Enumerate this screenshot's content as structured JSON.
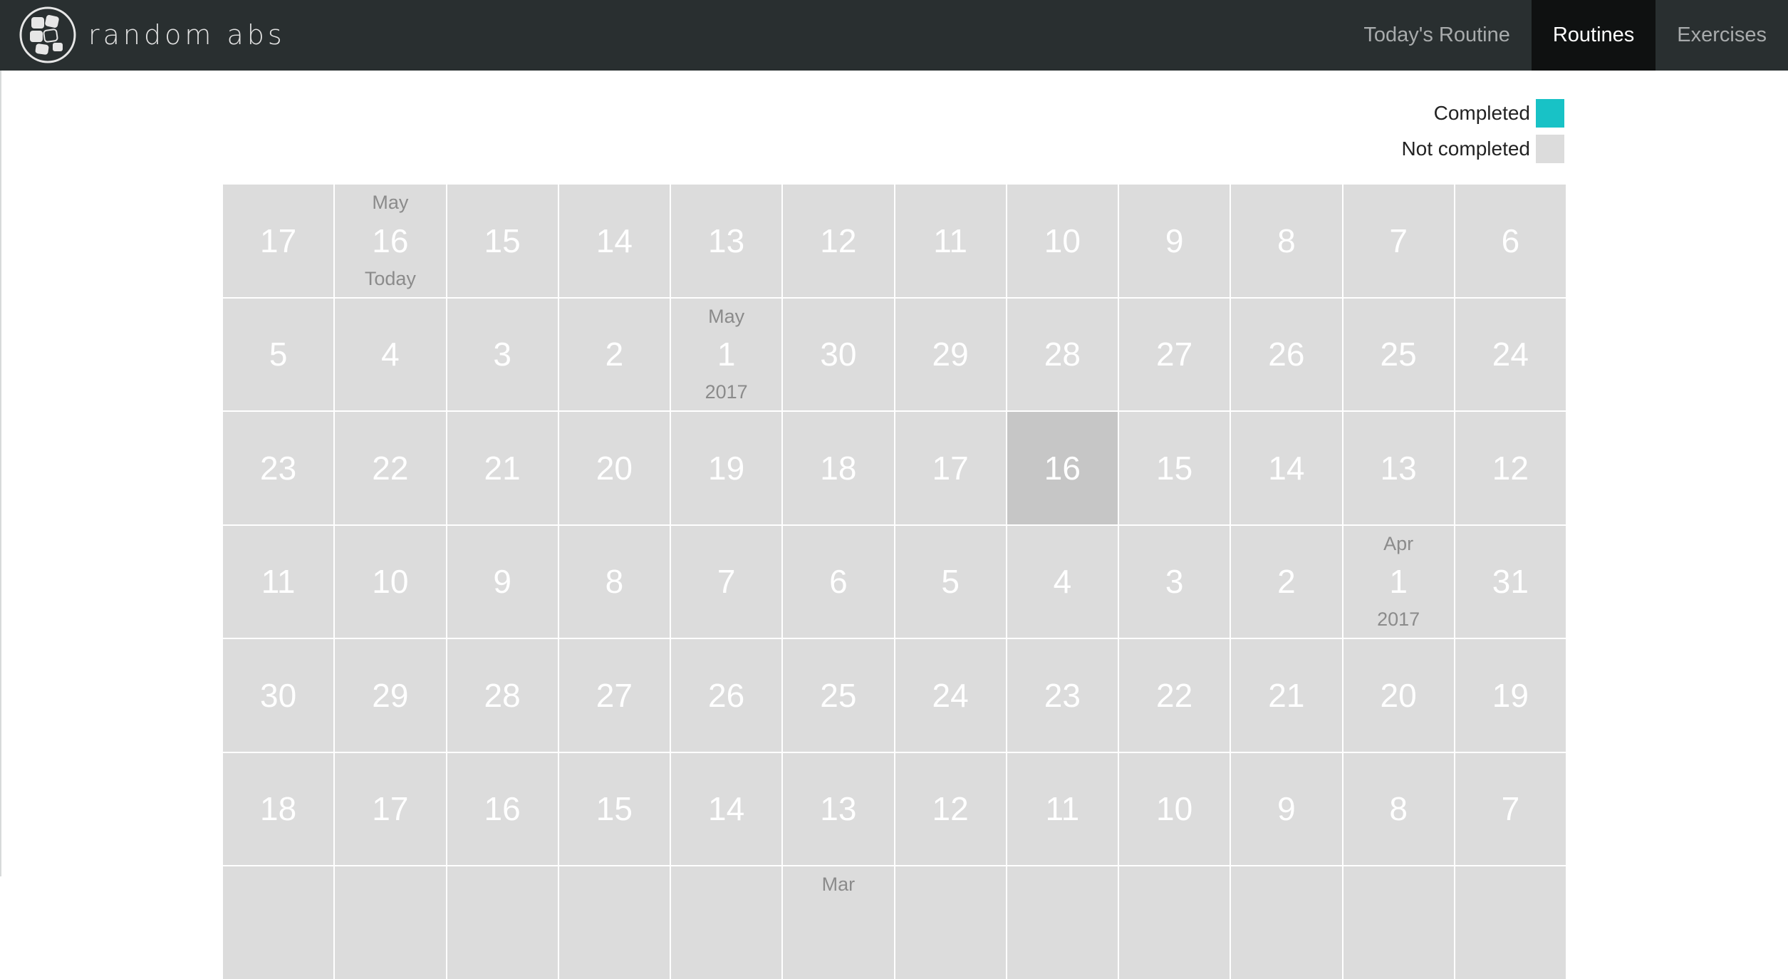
{
  "brand": {
    "name": "random abs",
    "logo_icon": "cubes-logo-icon"
  },
  "nav": {
    "items": [
      {
        "label": "Today's Routine",
        "active": false
      },
      {
        "label": "Routines",
        "active": true
      },
      {
        "label": "Exercises",
        "active": false
      }
    ]
  },
  "legend": {
    "completed_label": "Completed",
    "completed_color": "#18c2c6",
    "not_completed_label": "Not completed",
    "not_completed_color": "#dcdcdc"
  },
  "calendar": {
    "highlight_color": "#c6c6c6",
    "days": [
      {
        "day": "17"
      },
      {
        "day": "16",
        "month": "May",
        "note": "Today"
      },
      {
        "day": "15"
      },
      {
        "day": "14"
      },
      {
        "day": "13"
      },
      {
        "day": "12"
      },
      {
        "day": "11"
      },
      {
        "day": "10"
      },
      {
        "day": "9"
      },
      {
        "day": "8"
      },
      {
        "day": "7"
      },
      {
        "day": "6"
      },
      {
        "day": "5"
      },
      {
        "day": "4"
      },
      {
        "day": "3"
      },
      {
        "day": "2"
      },
      {
        "day": "1",
        "month": "May",
        "note": "2017"
      },
      {
        "day": "30"
      },
      {
        "day": "29"
      },
      {
        "day": "28"
      },
      {
        "day": "27"
      },
      {
        "day": "26"
      },
      {
        "day": "25"
      },
      {
        "day": "24"
      },
      {
        "day": "23"
      },
      {
        "day": "22"
      },
      {
        "day": "21"
      },
      {
        "day": "20"
      },
      {
        "day": "19"
      },
      {
        "day": "18"
      },
      {
        "day": "17"
      },
      {
        "day": "16",
        "highlight": true
      },
      {
        "day": "15"
      },
      {
        "day": "14"
      },
      {
        "day": "13"
      },
      {
        "day": "12"
      },
      {
        "day": "11"
      },
      {
        "day": "10"
      },
      {
        "day": "9"
      },
      {
        "day": "8"
      },
      {
        "day": "7"
      },
      {
        "day": "6"
      },
      {
        "day": "5"
      },
      {
        "day": "4"
      },
      {
        "day": "3"
      },
      {
        "day": "2"
      },
      {
        "day": "1",
        "month": "Apr",
        "note": "2017"
      },
      {
        "day": "31"
      },
      {
        "day": "30"
      },
      {
        "day": "29"
      },
      {
        "day": "28"
      },
      {
        "day": "27"
      },
      {
        "day": "26"
      },
      {
        "day": "25"
      },
      {
        "day": "24"
      },
      {
        "day": "23"
      },
      {
        "day": "22"
      },
      {
        "day": "21"
      },
      {
        "day": "20"
      },
      {
        "day": "19"
      },
      {
        "day": "18"
      },
      {
        "day": "17"
      },
      {
        "day": "16"
      },
      {
        "day": "15"
      },
      {
        "day": "14"
      },
      {
        "day": "13"
      },
      {
        "day": "12"
      },
      {
        "day": "11"
      },
      {
        "day": "10"
      },
      {
        "day": "9"
      },
      {
        "day": "8"
      },
      {
        "day": "7"
      },
      {
        "day": ""
      },
      {
        "day": ""
      },
      {
        "day": ""
      },
      {
        "day": ""
      },
      {
        "day": ""
      },
      {
        "day": "",
        "month": "Mar"
      },
      {
        "day": ""
      },
      {
        "day": ""
      },
      {
        "day": ""
      },
      {
        "day": ""
      },
      {
        "day": ""
      },
      {
        "day": ""
      }
    ]
  }
}
